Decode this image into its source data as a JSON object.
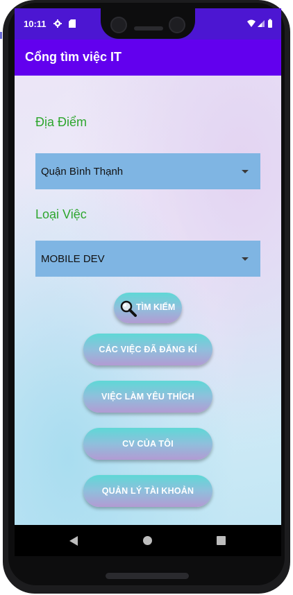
{
  "status_bar": {
    "time": "10:11",
    "icons": [
      "gear-icon",
      "sd-card-icon",
      "wifi-icon",
      "signal-icon",
      "battery-icon"
    ]
  },
  "app_bar": {
    "title": "Cổng tìm việc IT",
    "color": "#6200ee"
  },
  "form": {
    "location_label": "Địa Điểm",
    "location_value": "Quận Bình Thạnh",
    "job_type_label": "Loại Việc",
    "job_type_value": "MOBILE DEV"
  },
  "buttons": {
    "search": "TÌM KIẾM",
    "registered_jobs": "CÁC VIỆC ĐÃ ĐĂNG KÍ",
    "favorite_jobs": "VIỆC LÀM YÊU THÍCH",
    "my_cv": "CV CỦA TÔI",
    "account_management": "QUẢN LÝ TÀI KHOẢN"
  },
  "nav_bar": {
    "icons": [
      "back-icon",
      "home-icon",
      "recents-icon"
    ]
  },
  "colors": {
    "label_green": "#2ea62e",
    "spinner_blue": "#7fb5e3",
    "status_bar": "#4c16d2"
  }
}
